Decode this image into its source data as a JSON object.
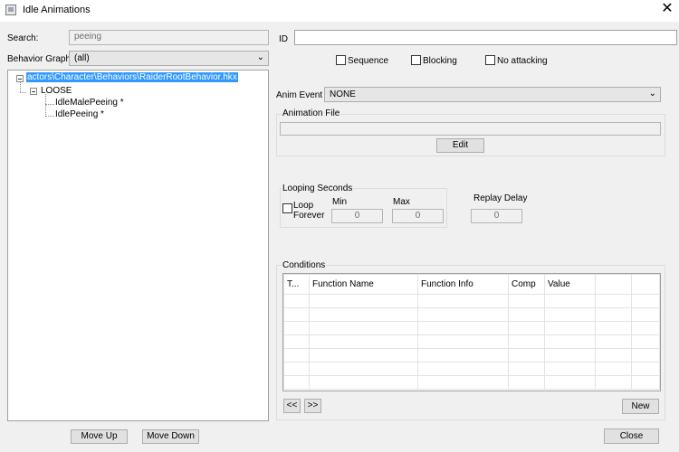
{
  "window": {
    "title": "Idle Animations",
    "close_glyph": "✕"
  },
  "search": {
    "label": "Search:",
    "value": "peeing"
  },
  "behavior_graph": {
    "label": "Behavior Graph",
    "selected": "(all)"
  },
  "tree": {
    "root": "actors\\Character\\Behaviors\\RaiderRootBehavior.hkx",
    "group": "LOOSE",
    "items": [
      "IdleMalePeeing *",
      "IdlePeeing *"
    ]
  },
  "id_field": {
    "label": "ID",
    "value": ""
  },
  "flags": {
    "sequence": "Sequence",
    "blocking": "Blocking",
    "no_attacking": "No attacking"
  },
  "anim_event": {
    "label": "Anim Event",
    "selected": "NONE"
  },
  "animation_file": {
    "label": "Animation File",
    "value": "",
    "edit_label": "Edit"
  },
  "looping": {
    "title": "Looping Seconds",
    "loop_forever_line1": "Loop",
    "loop_forever_line2": "Forever",
    "min_label": "Min",
    "min_value": "0",
    "max_label": "Max",
    "max_value": "0"
  },
  "replay_delay": {
    "label": "Replay Delay",
    "value": "0"
  },
  "conditions": {
    "title": "Conditions",
    "columns": [
      "T...",
      "Function Name",
      "Function Info",
      "Comp",
      "Value",
      ""
    ],
    "prev_label": "<<",
    "next_label": ">>",
    "new_label": "New"
  },
  "buttons": {
    "move_up": "Move Up",
    "move_down": "Move Down",
    "close": "Close"
  }
}
